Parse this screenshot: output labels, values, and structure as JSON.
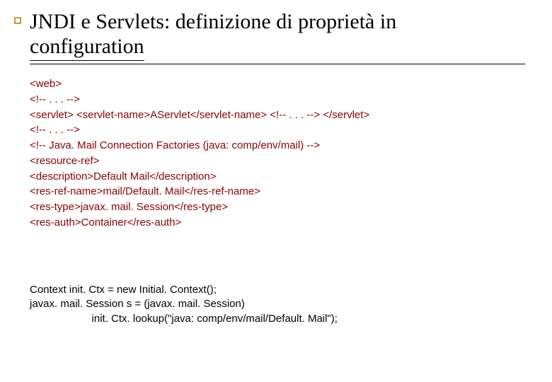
{
  "heading": {
    "line1": "JNDI e Servlets: definizione di proprietà in",
    "line2": "configuration"
  },
  "code": {
    "l1": "<web>",
    "l2": "<!-- . . . -->",
    "l3": "<servlet> <servlet-name>AServlet</servlet-name> <!-- . . . --> </servlet>",
    "l4": "<!-- . . . -->",
    "l5": "<!-- Java. Mail Connection Factories (java: comp/env/mail) -->",
    "l6": "<resource-ref>",
    "l7": "<description>Default Mail</description>",
    "l8": "<res-ref-name>mail/Default. Mail</res-ref-name>",
    "l9": "<res-type>javax. mail. Session</res-type>",
    "l10": "<res-auth>Container</res-auth>"
  },
  "java": {
    "l1": "Context init. Ctx = new Initial. Context();",
    "l2": "javax. mail. Session s = (javax. mail. Session)",
    "l3": "                     init. Ctx. lookup(\"java: comp/env/mail/Default. Mail\");"
  }
}
